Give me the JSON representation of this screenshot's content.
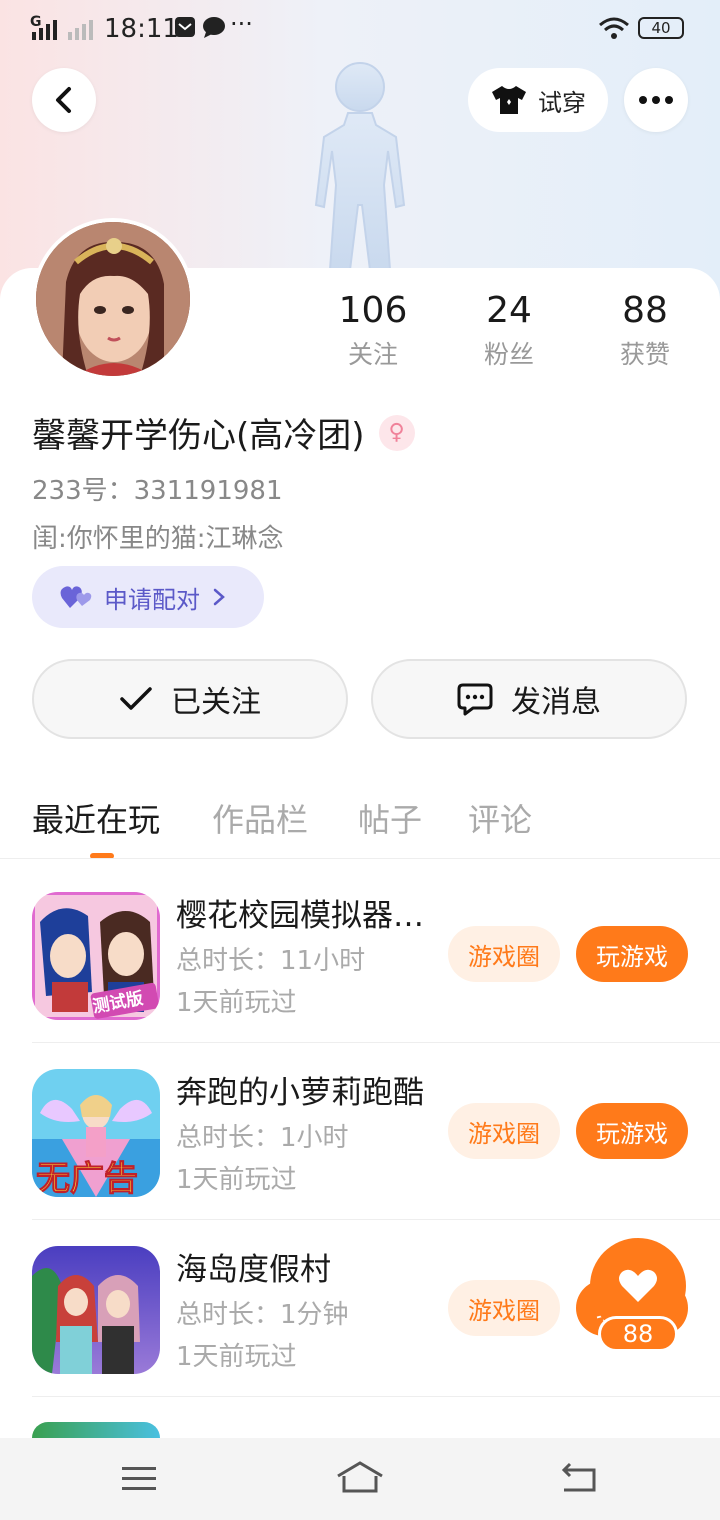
{
  "status_bar": {
    "time": "18:11",
    "network": "G",
    "battery": "40"
  },
  "header": {
    "tryon_label": "试穿"
  },
  "profile": {
    "stats": [
      {
        "value": "106",
        "label": "关注"
      },
      {
        "value": "24",
        "label": "粉丝"
      },
      {
        "value": "88",
        "label": "获赞"
      }
    ],
    "name": "馨馨开学伤心(高冷团)",
    "gender_icon": "♀",
    "id_line": "233号：331191981",
    "bio": "闺:你怀里的猫:江琳念",
    "pair_label": "申请配对"
  },
  "actions": {
    "followed_label": "已关注",
    "message_label": "发消息"
  },
  "tabs": [
    {
      "label": "最近在玩",
      "active": true
    },
    {
      "label": "作品栏",
      "active": false
    },
    {
      "label": "帖子",
      "active": false
    },
    {
      "label": "评论",
      "active": false
    }
  ],
  "games": [
    {
      "title": "樱花校园模拟器…",
      "duration": "总时长：11小时",
      "last_played": "1天前玩过",
      "icon_badge": "测试版"
    },
    {
      "title": "奔跑的小萝莉跑酷",
      "duration": "总时长：1小时",
      "last_played": "1天前玩过",
      "icon_badge": "无广告"
    },
    {
      "title": "海岛度假村",
      "duration": "总时长：1分钟",
      "last_played": "1天前玩过",
      "icon_badge": ""
    }
  ],
  "game_buttons": {
    "circle_label": "游戏圈",
    "play_label": "玩游戏"
  },
  "like_widget": {
    "count": "88"
  },
  "colors": {
    "accent": "#ff7a1a",
    "pair_bg": "#e9e9fb",
    "pair_text": "#5b59c8"
  }
}
